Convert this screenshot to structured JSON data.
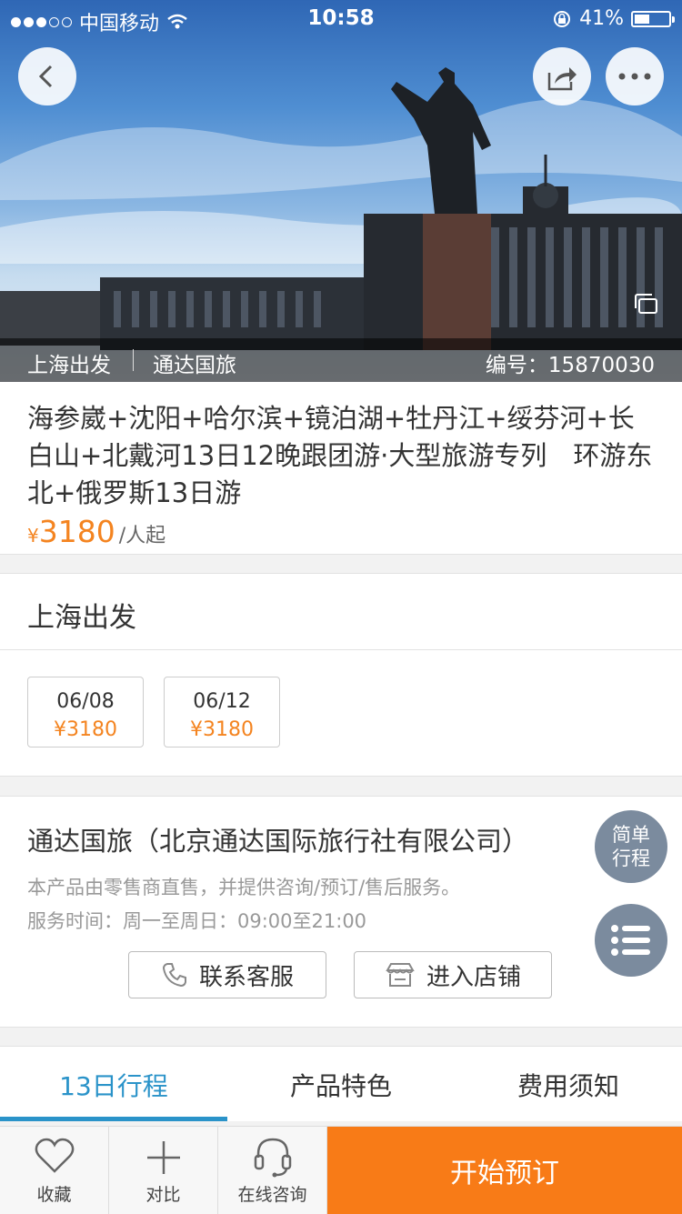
{
  "status_bar": {
    "carrier": "中国移动",
    "time": "10:58",
    "battery": "41%",
    "battery_level": 0.41
  },
  "hero": {
    "departure": "上海出发",
    "agency": "通达国旅",
    "code_label": "编号：",
    "code_value": "15870030"
  },
  "product": {
    "title": "海参崴+沈阳+哈尔滨+镜泊湖+牡丹江+绥芬河+长白山+北戴河13日12晚跟团游·大型旅游专列　环游东北+俄罗斯13日游",
    "currency": "¥",
    "price": "3180",
    "price_unit": "/人起"
  },
  "departure_city": "上海出发",
  "dates": [
    {
      "date": "06/08",
      "price": "¥3180"
    },
    {
      "date": "06/12",
      "price": "¥3180"
    }
  ],
  "seller": {
    "name": "通达国旅（北京通达国际旅行社有限公司）",
    "desc": "本产品由零售商直售，并提供咨询/预订/售后服务。",
    "hours": "服务时间：周一至周日：09:00至21:00",
    "contact_label": "联系客服",
    "store_label": "进入店铺"
  },
  "floating": {
    "simple_line1": "简单",
    "simple_line2": "行程"
  },
  "tabs": [
    {
      "label": "13日行程",
      "active": true
    },
    {
      "label": "产品特色",
      "active": false
    },
    {
      "label": "费用须知",
      "active": false
    }
  ],
  "bottom_bar": {
    "favorite": "收藏",
    "compare": "对比",
    "consult": "在线咨询",
    "book": "开始预订"
  },
  "colors": {
    "accent_orange": "#f48420",
    "book_orange": "#f87b17",
    "tab_blue": "#2a93c9",
    "float_gray": "#7b8b9e"
  }
}
